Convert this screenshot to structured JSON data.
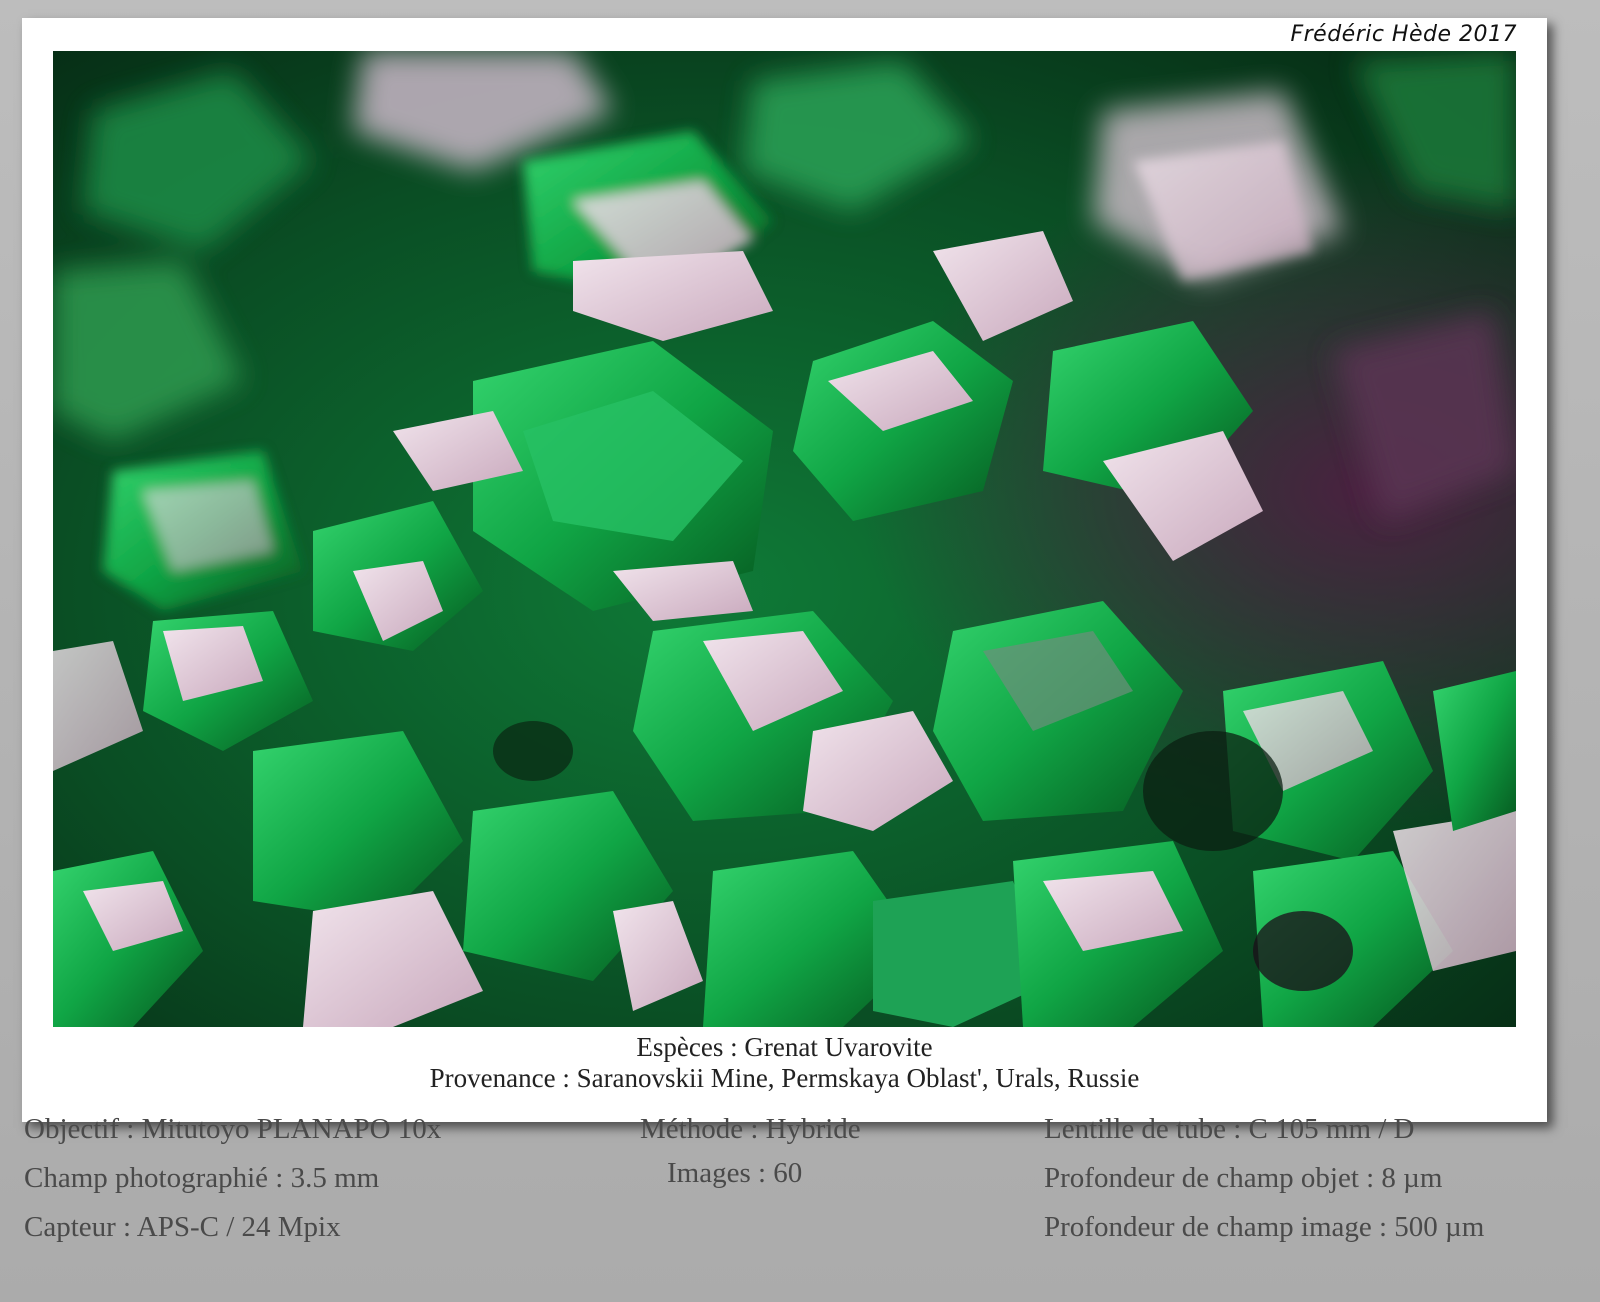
{
  "credit": "Frédéric Hède 2017",
  "caption": {
    "species": "Espèces : Grenat Uvarovite",
    "provenance": "Provenance : Saranovskii Mine, Permskaya Oblast', Urals, Russie"
  },
  "specs": {
    "left": [
      "Objectif : Mitutoyo PLANAPO 10x",
      "Champ photographié : 3.5 mm",
      "Capteur : APS-C / 24 Mpix"
    ],
    "middle": [
      "Méthode : Hybride",
      "Images : 60"
    ],
    "right": [
      "Lentille de tube : C 105 mm / D",
      "Profondeur de champ objet : 8 µm",
      "Profondeur de champ image : 500 µm"
    ]
  },
  "colors": {
    "crystal_green": "#12a84a",
    "deep_green": "#063d1c",
    "facet_pink": "#e9d3df",
    "shadow_purple": "#3c1a33",
    "frame_gray": "#b2b2b2"
  }
}
